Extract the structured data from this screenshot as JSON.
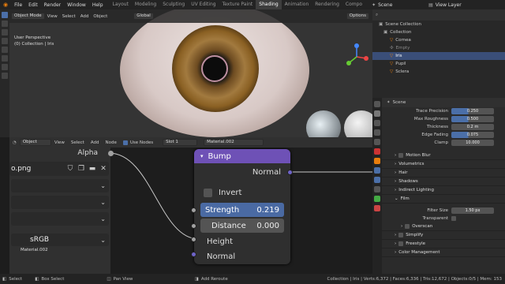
{
  "menu": [
    "File",
    "Edit",
    "Render",
    "Window",
    "Help"
  ],
  "workspaces": [
    {
      "label": "Layout",
      "active": false
    },
    {
      "label": "Modeling",
      "active": false
    },
    {
      "label": "Sculpting",
      "active": false
    },
    {
      "label": "UV Editing",
      "active": false
    },
    {
      "label": "Texture Paint",
      "active": false
    },
    {
      "label": "Shading",
      "active": true
    },
    {
      "label": "Animation",
      "active": false
    },
    {
      "label": "Rendering",
      "active": false
    },
    {
      "label": "Compo",
      "active": false
    }
  ],
  "scene": "Scene",
  "view_layer": "View Layer",
  "viewport": {
    "mode": "Object Mode",
    "menus": [
      "View",
      "Select",
      "Add",
      "Object"
    ],
    "transform": "Global",
    "options": "Options",
    "info_line1": "User Perspective",
    "info_line2": "(0) Collection | Iris"
  },
  "outliner": {
    "root": "Scene Collection",
    "collection": "Collection",
    "items": [
      {
        "label": "Cornea",
        "selected": false
      },
      {
        "label": "Empty",
        "selected": false
      },
      {
        "label": "Iris",
        "selected": true
      },
      {
        "label": "Pupil",
        "selected": false
      },
      {
        "label": "Sclera",
        "selected": false
      }
    ]
  },
  "properties": {
    "scene_title": "Scene",
    "fields": [
      {
        "label": "Trace Precision",
        "value": "0.250",
        "bar": true
      },
      {
        "label": "Max Roughness",
        "value": "0.500",
        "bar": true
      },
      {
        "label": "Thickness",
        "value": "0.2 m",
        "bar": false
      },
      {
        "label": "Edge Fading",
        "value": "0.075",
        "bar": true
      },
      {
        "label": "Clamp",
        "value": "10.000",
        "bar": false
      }
    ],
    "sections": [
      "Motion Blur",
      "Volumetrics",
      "Hair",
      "Shadows",
      "Indirect Lighting",
      "Film"
    ],
    "filter_label": "Filter Size",
    "filter_value": "1.50 px",
    "transparent_label": "Transparent",
    "sub_sections": [
      "Overscan",
      "Simplify",
      "Freestyle",
      "Color Management"
    ]
  },
  "node_editor": {
    "object": "Object",
    "menus": [
      "View",
      "Select",
      "Add",
      "Node"
    ],
    "use_nodes": "Use Nodes",
    "slot": "Slot 1",
    "material": "Material.002",
    "alpha": "Alpha",
    "image_name": "o.png",
    "color_space": "sRGB",
    "tooltip_material": "Material.002"
  },
  "bump_node": {
    "title": "Bump",
    "output": "Normal",
    "invert": "Invert",
    "strength_label": "Strength",
    "strength_value": "0.219",
    "distance_label": "Distance",
    "distance_value": "0.000",
    "height": "Height",
    "normal_in": "Normal"
  },
  "status": {
    "select": "Select",
    "box_select": "Box Select",
    "pan_view": "Pan View",
    "add_reroute": "Add Reroute",
    "stats": "Collection | Iris | Verts:6,372 | Faces:6,336 | Tris:12,672 | Objects:0/5 | Mem: 153"
  },
  "colors": {
    "accent": "#4b6fa8",
    "bump_header": "#6e51b6",
    "selected_row": "#3a4e78"
  }
}
